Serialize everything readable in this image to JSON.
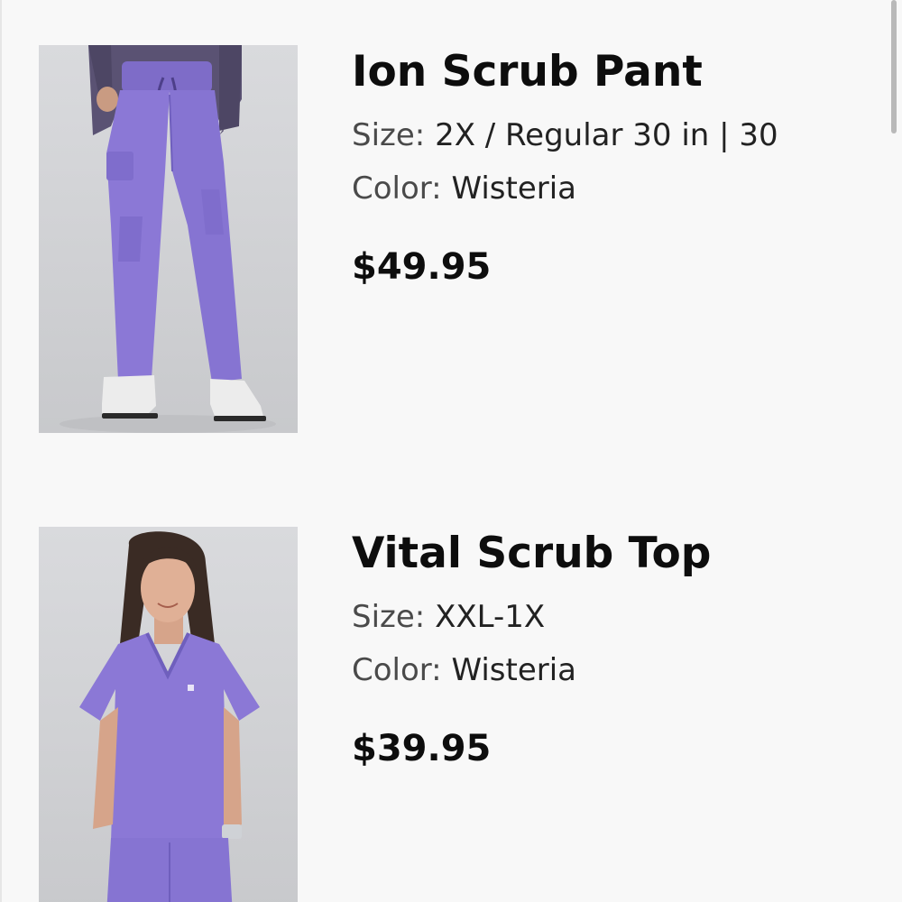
{
  "cart_items": [
    {
      "name": "Ion Scrub Pant",
      "size_label": "Size:",
      "size_value": "2X / Regular 30 in | 30",
      "color_label": "Color:",
      "color_value": "Wisteria",
      "price": "$49.95",
      "image_icon": "scrub-pant-product-image"
    },
    {
      "name": "Vital Scrub Top",
      "size_label": "Size:",
      "size_value": "XXL-1X",
      "color_label": "Color:",
      "color_value": "Wisteria",
      "price": "$39.95",
      "image_icon": "scrub-top-product-image"
    }
  ],
  "colors": {
    "background": "#f8f8f8",
    "wisteria": "#8b78d6",
    "text": "#111111",
    "muted_text": "#4a4a4a"
  }
}
